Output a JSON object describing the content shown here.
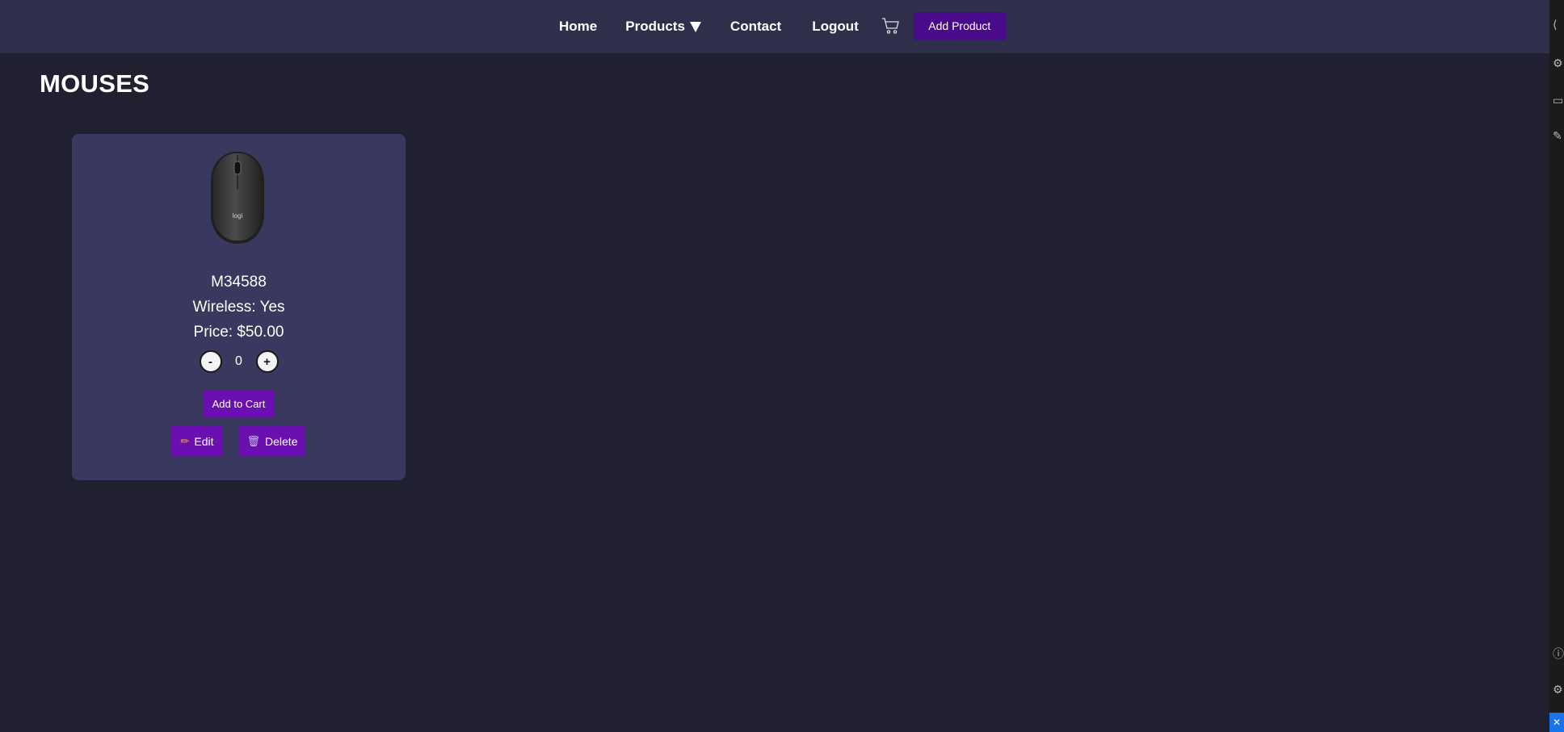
{
  "nav": {
    "home": "Home",
    "products": "Products",
    "contact": "Contact",
    "logout": "Logout",
    "cart_icon": "cart-icon",
    "add_product": "Add Product"
  },
  "page": {
    "title": "MOUSES"
  },
  "product": {
    "image_icon": "computer-mouse-image",
    "image_brand": "logi",
    "model": "M34588",
    "wireless": "Wireless: Yes",
    "price": "Price: $50.00",
    "quantity": "0",
    "minus": "-",
    "plus": "+",
    "add_to_cart": "Add to Cart",
    "edit": "Edit",
    "delete": "Delete"
  },
  "colors": {
    "background": "#202030",
    "navbar": "#2f2f4b",
    "card": "#393960",
    "accent": "#6a0fb0",
    "add_product_button": "#4a0a8c"
  }
}
